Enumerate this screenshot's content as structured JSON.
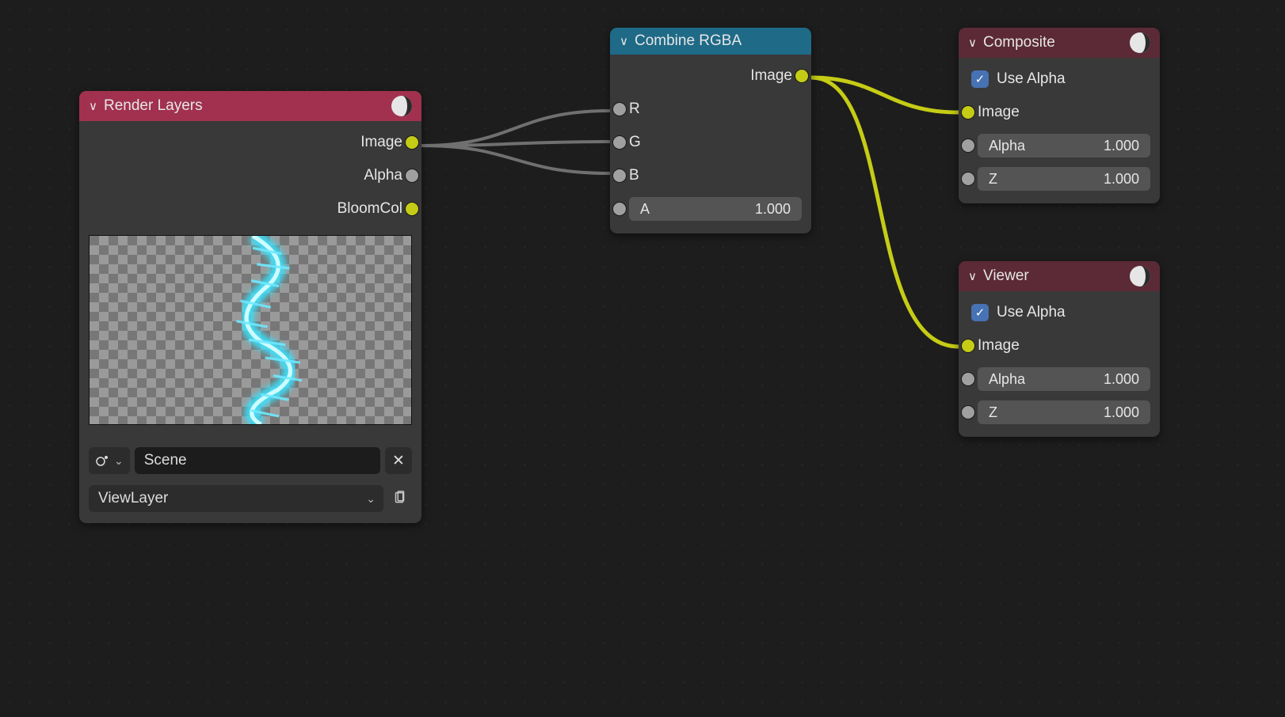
{
  "nodes": {
    "render": {
      "title": "Render Layers",
      "outputs": {
        "image": "Image",
        "alpha": "Alpha",
        "bloom": "BloomCol"
      },
      "scene": "Scene",
      "layer": "ViewLayer"
    },
    "combine": {
      "title": "Combine RGBA",
      "outputs": {
        "image": "Image"
      },
      "inputs": {
        "r": "R",
        "g": "G",
        "b": "B"
      },
      "a_label": "A",
      "a_value": "1.000"
    },
    "composite": {
      "title": "Composite",
      "use_alpha": "Use Alpha",
      "image": "Image",
      "alpha_label": "Alpha",
      "alpha_value": "1.000",
      "z_label": "Z",
      "z_value": "1.000"
    },
    "viewer": {
      "title": "Viewer",
      "use_alpha": "Use Alpha",
      "image": "Image",
      "alpha_label": "Alpha",
      "alpha_value": "1.000",
      "z_label": "Z",
      "z_value": "1.000"
    }
  }
}
